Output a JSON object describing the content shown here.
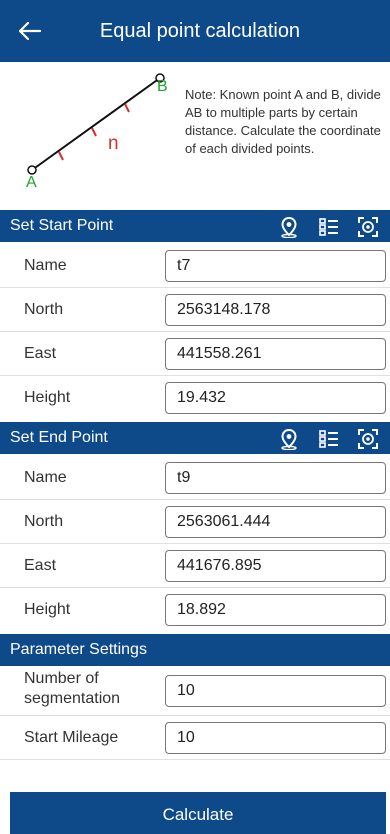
{
  "header": {
    "title": "Equal point calculation"
  },
  "diagram": {
    "label_a": "A",
    "label_b": "B",
    "label_n": "n",
    "note": "Note: Known point A and B, divide AB to multiple parts by certain distance. Calculate the coordinate of each divided points."
  },
  "start_section": {
    "title": "Set Start Point",
    "fields": [
      {
        "label": "Name",
        "value": "t7"
      },
      {
        "label": "North",
        "value": "2563148.178"
      },
      {
        "label": "East",
        "value": "441558.261"
      },
      {
        "label": "Height",
        "value": "19.432"
      }
    ]
  },
  "end_section": {
    "title": "Set End Point",
    "fields": [
      {
        "label": "Name",
        "value": "t9"
      },
      {
        "label": "North",
        "value": "2563061.444"
      },
      {
        "label": "East",
        "value": "441676.895"
      },
      {
        "label": "Height",
        "value": "18.892"
      }
    ]
  },
  "params": {
    "title": "Parameter Settings",
    "segmentation_label": "Number of segmentation",
    "segmentation_value": "10",
    "mileage_label": "Start Mileage",
    "mileage_value": "10"
  },
  "actions": {
    "calculate": "Calculate"
  },
  "icons": {
    "back": "arrow-left-icon",
    "location": "location-pin-icon",
    "list": "point-list-icon",
    "scan": "scan-target-icon"
  },
  "colors": {
    "primary": "#0e4a8a",
    "point_a": "#22a52b",
    "point_b": "#22a52b",
    "tick": "#d0312d"
  }
}
